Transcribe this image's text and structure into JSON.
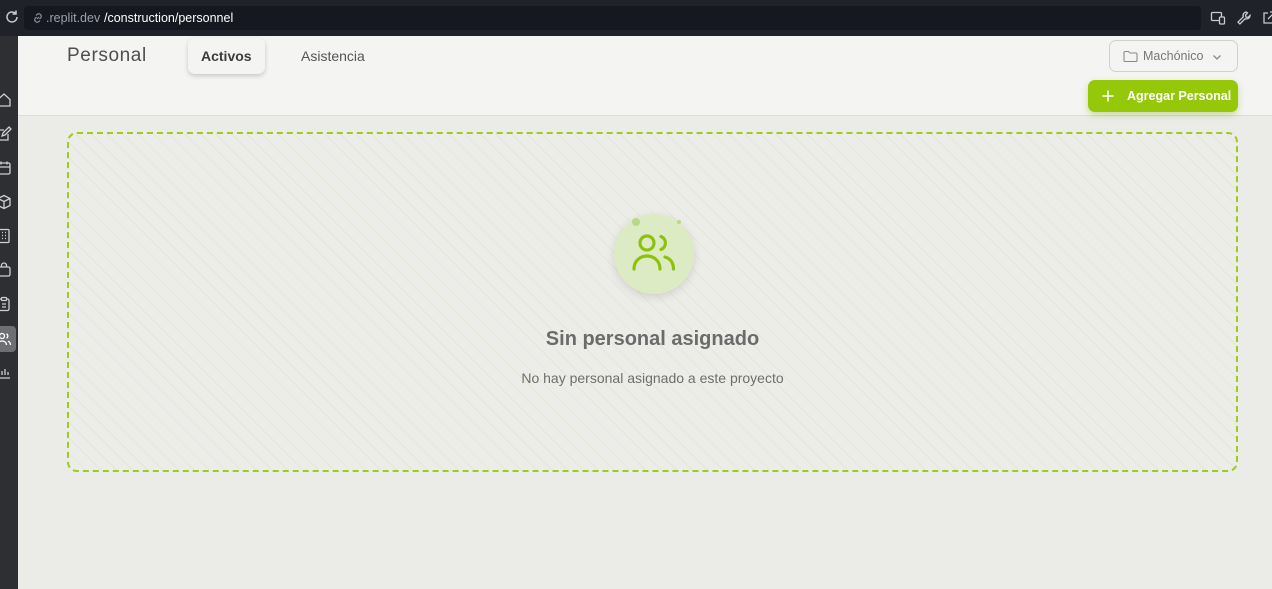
{
  "browser": {
    "url_domain": ".replit.dev",
    "url_path": "/construction/personnel"
  },
  "header": {
    "title": "Personal",
    "tabs": [
      {
        "label": "Activos",
        "active": true
      },
      {
        "label": "Asistencia",
        "active": false
      }
    ],
    "project_selector": {
      "value": "Machónico"
    },
    "add_button_label": "Agregar Personal"
  },
  "sidebar": {
    "items": [
      {
        "icon": "home-icon"
      },
      {
        "icon": "edit-icon"
      },
      {
        "icon": "calendar-icon"
      },
      {
        "icon": "box-icon"
      },
      {
        "icon": "building-icon"
      },
      {
        "icon": "bag-icon"
      },
      {
        "icon": "clipboard-icon"
      },
      {
        "icon": "users-icon",
        "active": true
      },
      {
        "icon": "chart-icon"
      }
    ]
  },
  "empty_state": {
    "icon": "users-icon",
    "title": "Sin personal asignado",
    "subtitle": "No hay personal asignado a este proyecto"
  },
  "colors": {
    "accent": "#96c80a",
    "background": "#ebebe7",
    "sidebar": "#2d2f32"
  }
}
